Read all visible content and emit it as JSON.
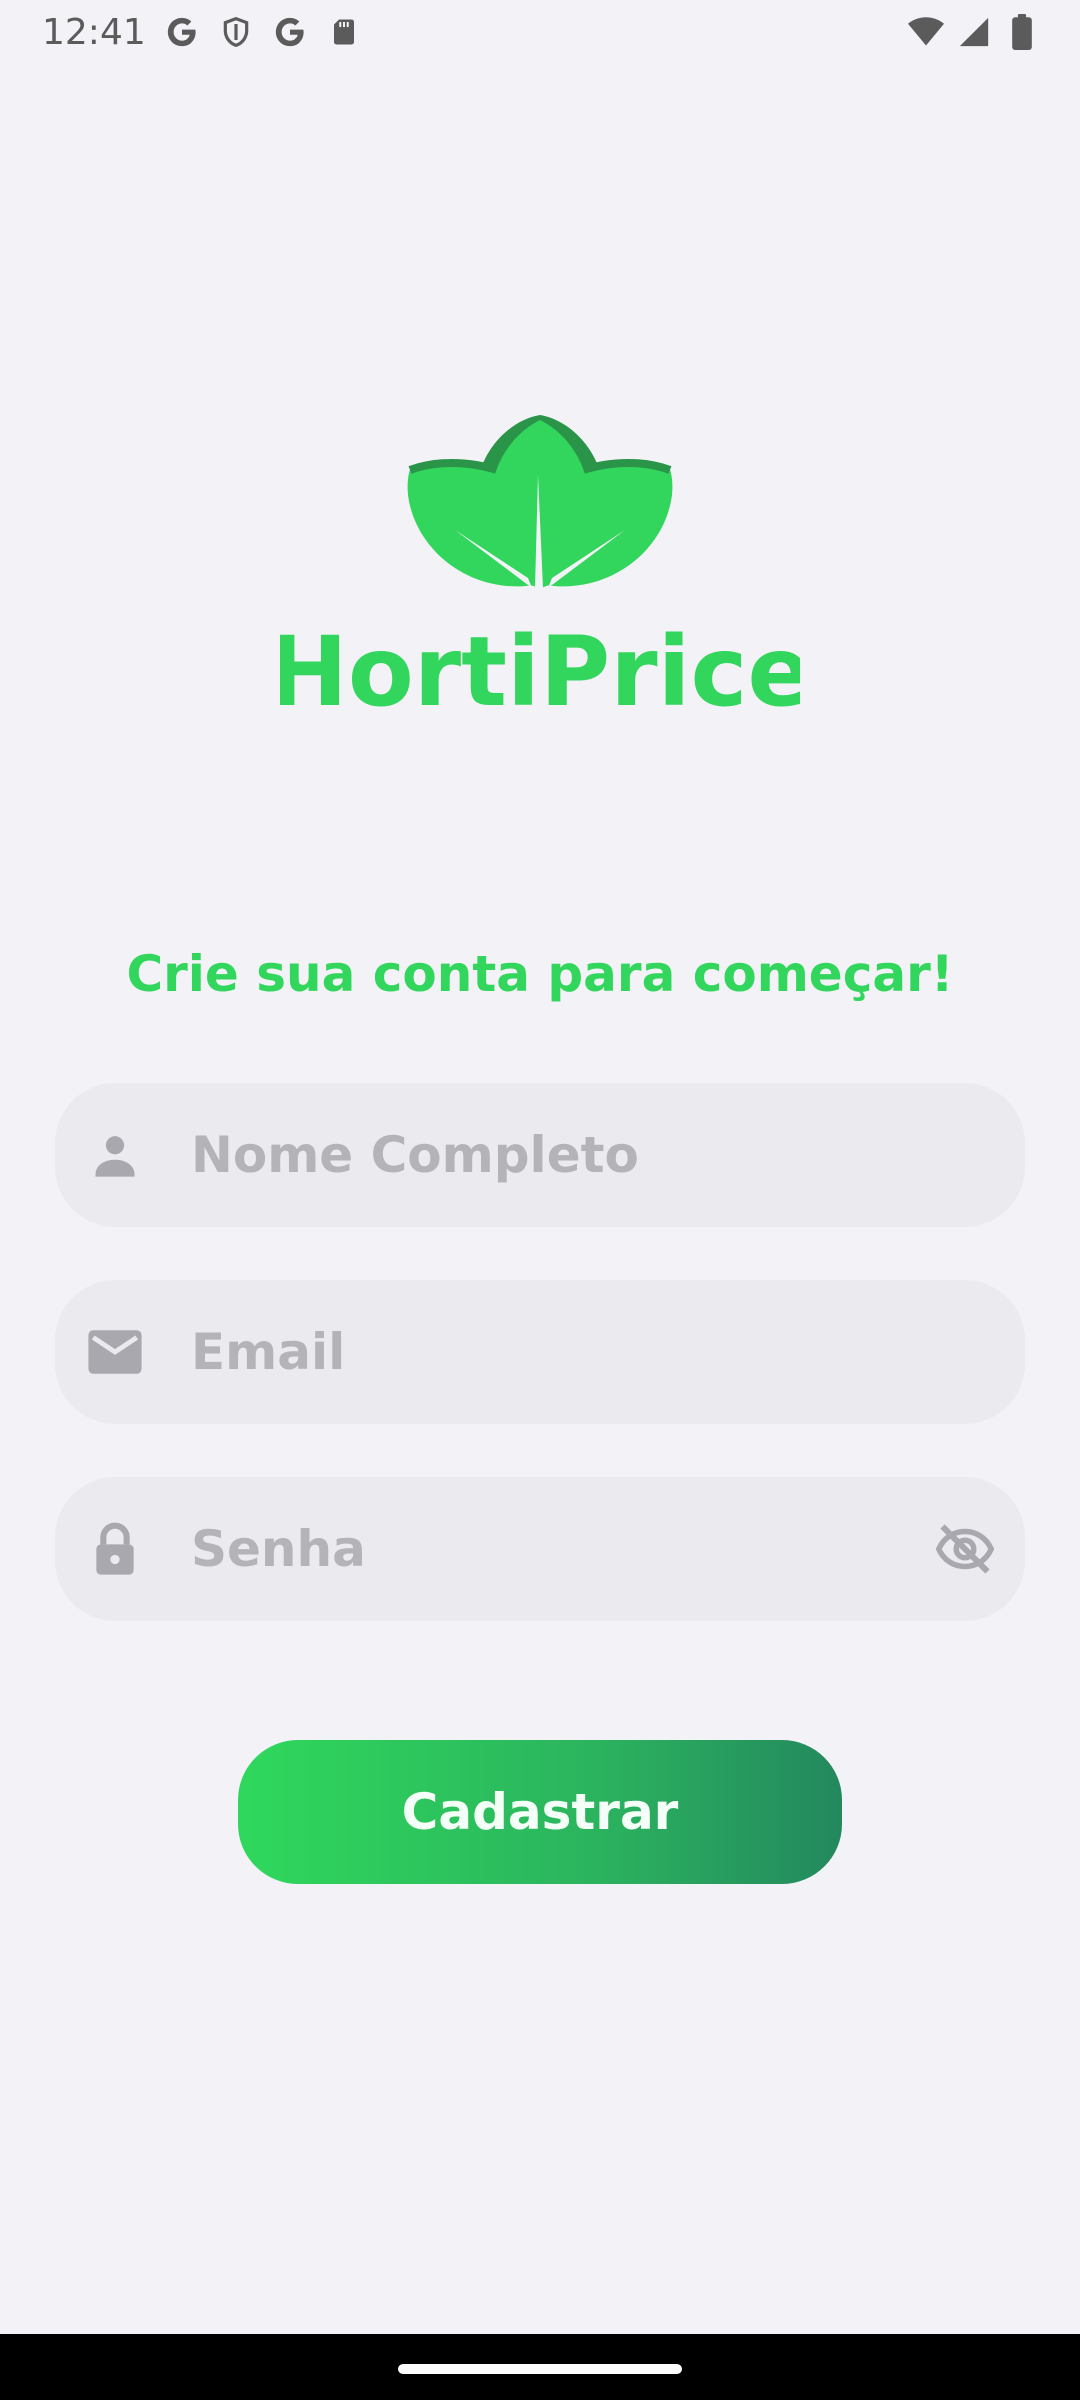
{
  "status_bar": {
    "time": "12:41",
    "left_icons": [
      "google-icon",
      "shield-icon",
      "google-icon",
      "sd-card-icon"
    ],
    "right_icons": [
      "wifi-icon",
      "signal-icon",
      "battery-icon"
    ]
  },
  "logo": {
    "text": "HortiPrice",
    "colors": {
      "primary": "#33d65c",
      "dark": "#2a8a4a"
    }
  },
  "headline": "Crie sua conta para começar!",
  "form": {
    "name": {
      "placeholder": "Nome Completo",
      "value": "",
      "icon": "person-icon"
    },
    "email": {
      "placeholder": "Email",
      "value": "",
      "icon": "mail-icon"
    },
    "password": {
      "placeholder": "Senha",
      "value": "",
      "icon": "lock-icon",
      "toggle_icon": "eye-off-icon"
    }
  },
  "submit_label": "Cadastrar",
  "colors": {
    "background": "#f2f2f7",
    "accent": "#33d65c",
    "field_bg": "#eaeaef",
    "placeholder": "#b3b3b8",
    "icon": "#a8a8ae"
  }
}
